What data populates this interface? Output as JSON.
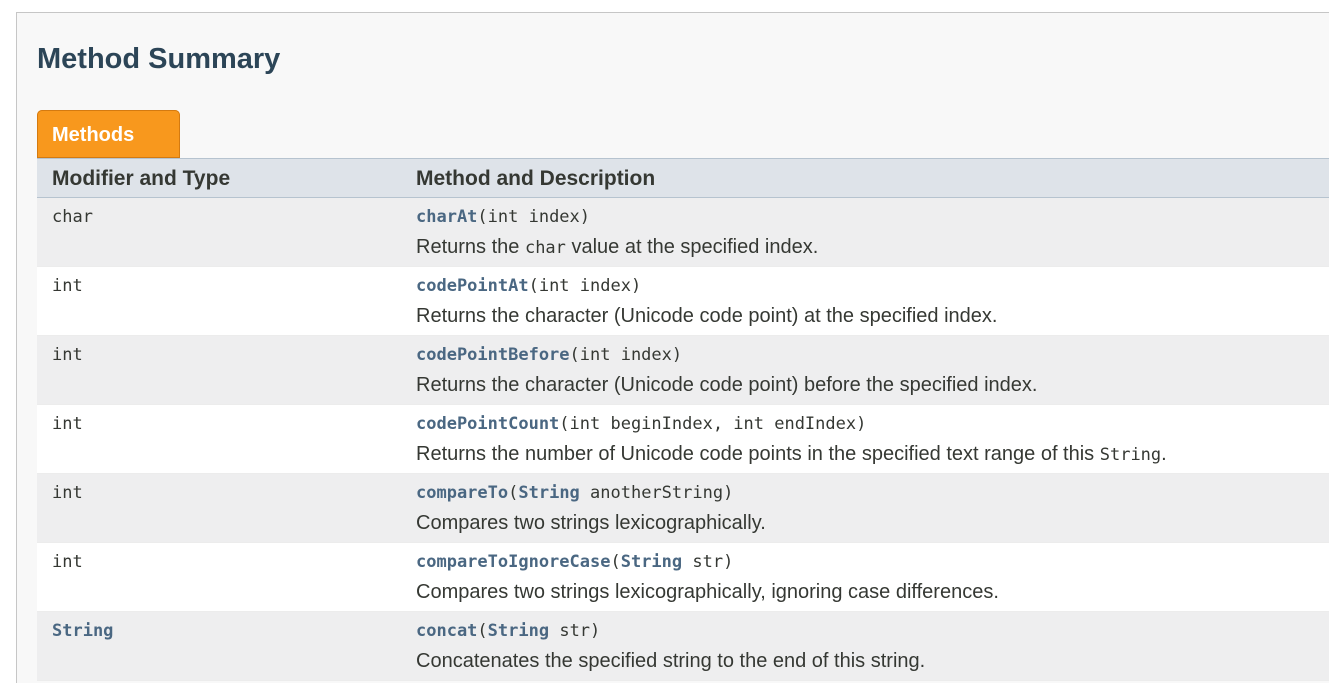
{
  "section": {
    "title": "Method Summary"
  },
  "tab": {
    "label": "Methods"
  },
  "columns": [
    "Modifier and Type",
    "Method and Description"
  ],
  "rows": [
    {
      "type": "char",
      "method": "charAt",
      "params_pre": "(int index)",
      "desc": "Returns the ",
      "desc_code": "char",
      "desc_post": " value at the specified index."
    },
    {
      "type": "int",
      "method": "codePointAt",
      "params_pre": "(int index)",
      "desc": "Returns the character (Unicode code point) at the specified index."
    },
    {
      "type": "int",
      "method": "codePointBefore",
      "params_pre": "(int index)",
      "desc": "Returns the character (Unicode code point) before the specified index."
    },
    {
      "type": "int",
      "method": "codePointCount",
      "params_pre": "(int beginIndex, int endIndex)",
      "desc": "Returns the number of Unicode code points in the specified text range of this ",
      "desc_code": "String",
      "desc_post": "."
    },
    {
      "type": "int",
      "method": "compareTo",
      "params_pre": "(",
      "param_type": "String",
      "params_post": " anotherString)",
      "desc": "Compares two strings lexicographically."
    },
    {
      "type": "int",
      "method": "compareToIgnoreCase",
      "params_pre": "(",
      "param_type": "String",
      "params_post": " str)",
      "desc": "Compares two strings lexicographically, ignoring case differences."
    },
    {
      "type": "String",
      "type_link": true,
      "method": "concat",
      "params_pre": "(",
      "param_type": "String",
      "params_post": " str)",
      "desc": "Concatenates the specified string to the end of this string."
    }
  ],
  "colors": {
    "tab": "#f8981d",
    "header": "#dee3e9",
    "link": "#4a6782",
    "alt_row": "#eeeeef"
  }
}
